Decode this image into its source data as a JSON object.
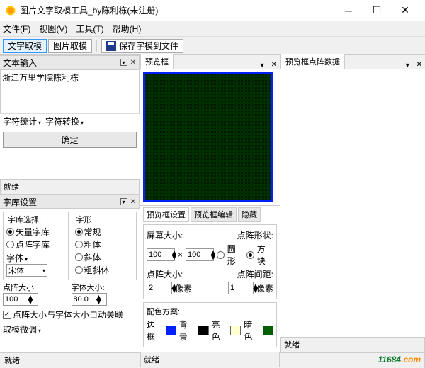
{
  "titlebar": {
    "title": "图片文字取模工具_by陈利栋(未注册)"
  },
  "menubar": {
    "file": "文件(F)",
    "view": "视图(V)",
    "tool": "工具(T)",
    "help": "帮助(H)"
  },
  "toolbar": {
    "text_mode": "文字取模",
    "image_mode": "图片取模",
    "save_font": "保存字模到文件"
  },
  "left": {
    "text_input": {
      "header": "文本输入",
      "content": "浙江万里学院陈利栋",
      "char_stat": "字符统计",
      "char_conv": "字符转换",
      "confirm": "确定",
      "status": "就绪"
    },
    "font_settings": {
      "header": "字库设置",
      "lib_select_label": "字库选择:",
      "vector": "矢量字库",
      "bitmap": "点阵字库",
      "font_label": "字体",
      "font_value": "宋体",
      "glyph_label": "字形",
      "regular": "常规",
      "bold": "粗体",
      "italic": "斜体",
      "bold_italic": "粗斜体",
      "dot_size_label": "点阵大小:",
      "dot_size": "100",
      "font_size_label": "字体大小:",
      "font_size": "80.0",
      "auto_link": "点阵大小与字体大小自动关联",
      "fine_tune": "取模微调"
    }
  },
  "mid": {
    "preview_header": "预览框",
    "ps_tabs": {
      "settings": "预览框设置",
      "edit": "预览框编辑",
      "hide": "隐藏"
    },
    "screen_size_label": "屏幕大小:",
    "sw": "100",
    "sh": "100",
    "dot_shape_label": "点阵形状:",
    "circle": "圆形",
    "square": "方块",
    "dot_size2_label": "点阵大小:",
    "dot_size2": "2",
    "px_unit": "像素",
    "dot_gap_label": "点阵间距:",
    "dot_gap": "1",
    "color_scheme": "配色方案:",
    "border_lbl": "边框",
    "bg_lbl": "背景",
    "light_lbl": "亮色",
    "dark_lbl": "暗色",
    "status": "就绪"
  },
  "right": {
    "header": "预览框点阵数据",
    "status": "就绪"
  },
  "colors": {
    "border": "#0020ff",
    "bg": "#000000",
    "light": "#ffffd0",
    "dark": "#006000"
  },
  "watermark": {
    "text": "11684",
    "suffix": ".com"
  }
}
